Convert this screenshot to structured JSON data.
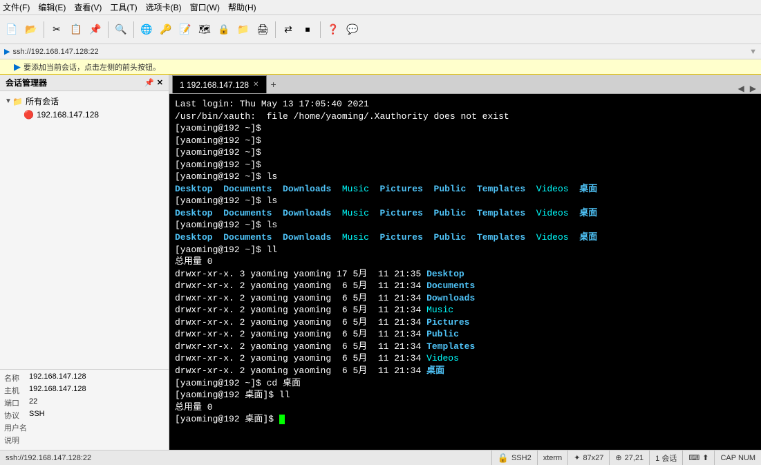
{
  "menubar": {
    "items": [
      "文件(F)",
      "编辑(E)",
      "查看(V)",
      "工具(T)",
      "选项卡(B)",
      "窗口(W)",
      "帮助(H)"
    ]
  },
  "addressbar": {
    "text": "ssh://192.168.147.128:22"
  },
  "infobar": {
    "text": "要添加当前会话，点击左侧的前头按钮。"
  },
  "sidebar": {
    "title": "会话管理器",
    "tree": {
      "root_label": "所有会话",
      "child_label": "192.168.147.128"
    },
    "props": [
      {
        "label": "名称",
        "value": "192.168.147.128"
      },
      {
        "label": "主机",
        "value": "192.168.147.128"
      },
      {
        "label": "端口",
        "value": "22"
      },
      {
        "label": "协议",
        "value": "SSH"
      },
      {
        "label": "用户名",
        "value": ""
      },
      {
        "label": "说明",
        "value": ""
      }
    ]
  },
  "tab": {
    "label": "1 192.168.147.128",
    "add_label": "+"
  },
  "terminal": {
    "lines": [
      "Last login: Thu May 13 17:05:40 2021",
      "/usr/bin/xauth:  file /home/yaoming/.Xauthority does not exist",
      "[yaoming@192 ~]$",
      "[yaoming@192 ~]$",
      "[yaoming@192 ~]$",
      "[yaoming@192 ~]$",
      "[yaoming@192 ~]$ ls"
    ],
    "ls_row1": {
      "dirs": [
        "Desktop",
        "Documents",
        "Downloads",
        "Music",
        "Pictures",
        "Public",
        "Templates",
        "Videos",
        "桌面"
      ]
    },
    "prompt_ls2": "[yaoming@192 ~]$ ls",
    "ls_row2": {
      "dirs": [
        "Desktop",
        "Documents",
        "Downloads",
        "Music",
        "Pictures",
        "Public",
        "Templates",
        "Videos",
        "桌面"
      ]
    },
    "prompt_ls3": "[yaoming@192 ~]$ ls",
    "ls_row3": {
      "dirs": [
        "Desktop",
        "Documents",
        "Downloads",
        "Music",
        "Pictures",
        "Public",
        "Templates",
        "Videos",
        "桌面"
      ]
    },
    "prompt_ll": "[yaoming@192 ~]$ ll",
    "total_line": "总用量 0",
    "ll_entries": [
      {
        "perm": "drwxr-xr-x.",
        "links": "3",
        "user": "yaoming",
        "group": "yaoming",
        "size": "17",
        "month": "5月",
        "day": "11",
        "time": "21:35",
        "name": "Desktop"
      },
      {
        "perm": "drwxr-xr-x.",
        "links": "2",
        "user": "yaoming",
        "group": "yaoming",
        "size": "6",
        "month": "5月",
        "day": "11",
        "time": "21:34",
        "name": "Documents"
      },
      {
        "perm": "drwxr-xr-x.",
        "links": "2",
        "user": "yaoming",
        "group": "yaoming",
        "size": "6",
        "month": "5月",
        "day": "11",
        "time": "21:34",
        "name": "Downloads"
      },
      {
        "perm": "drwxr-xr-x.",
        "links": "2",
        "user": "yaoming",
        "group": "yaoming",
        "size": "6",
        "month": "5月",
        "day": "11",
        "time": "21:34",
        "name": "Music"
      },
      {
        "perm": "drwxr-xr-x.",
        "links": "2",
        "user": "yaoming",
        "group": "yaoming",
        "size": "6",
        "month": "5月",
        "day": "11",
        "time": "21:34",
        "name": "Pictures"
      },
      {
        "perm": "drwxr-xr-x.",
        "links": "2",
        "user": "yaoming",
        "group": "yaoming",
        "size": "6",
        "month": "5月",
        "day": "11",
        "time": "21:34",
        "name": "Public"
      },
      {
        "perm": "drwxr-xr-x.",
        "links": "2",
        "user": "yaoming",
        "group": "yaoming",
        "size": "6",
        "month": "5月",
        "day": "11",
        "time": "21:34",
        "name": "Templates"
      },
      {
        "perm": "drwxr-xr-x.",
        "links": "2",
        "user": "yaoming",
        "group": "yaoming",
        "size": "6",
        "month": "5月",
        "day": "11",
        "time": "21:34",
        "name": "Videos"
      },
      {
        "perm": "drwxr-xr-x.",
        "links": "2",
        "user": "yaoming",
        "group": "yaoming",
        "size": "6",
        "month": "5月",
        "day": "11",
        "time": "21:34",
        "name": "桌面"
      }
    ],
    "prompt_cd": "[yaoming@192 ~]$ cd 桌面",
    "prompt_ll2": "[yaoming@192 桌面]$ ll",
    "total_line2": "总用量 0",
    "prompt_final": "[yaoming@192 桌面]$"
  },
  "statusbar": {
    "addr": "ssh://192.168.147.128:22",
    "ssh_label": "SSH2",
    "term_label": "xterm",
    "cols": "87x27",
    "pos": "27,21",
    "sessions": "1 会话",
    "cap": "CAP NUM"
  }
}
